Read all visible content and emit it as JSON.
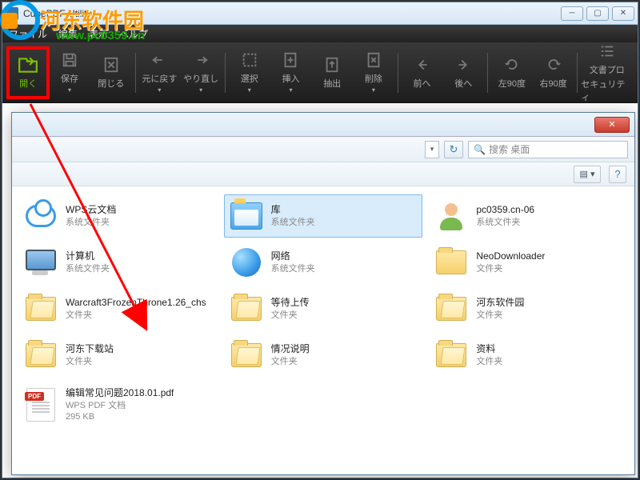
{
  "window": {
    "title": "CubePDF Utility"
  },
  "watermark": {
    "text": "河东软件园",
    "url": "www.pc0359.cn"
  },
  "menu": {
    "file": "ファイル",
    "edit": "編集",
    "view": "表示",
    "help": "ヘルプ"
  },
  "toolbar": {
    "open": "開く",
    "save": "保存",
    "close": "閉じる",
    "undo": "元に戻す",
    "redo": "やり直し",
    "select": "選択",
    "insert": "挿入",
    "extract": "抽出",
    "delete": "削除",
    "prev": "前へ",
    "next": "後へ",
    "rotate_l": "左90度",
    "rotate_r": "右90度",
    "docprops": "文書プロ",
    "security": "セキュリティ"
  },
  "dialog": {
    "search_placeholder": "搜索 桌面",
    "items": [
      {
        "name": "WPS云文档",
        "type": "系统文件夹",
        "icon": "cloud"
      },
      {
        "name": "库",
        "type": "系统文件夹",
        "icon": "lib",
        "selected": true
      },
      {
        "name": "pc0359.cn-06",
        "type": "系统文件夹",
        "icon": "user"
      },
      {
        "name": "计算机",
        "type": "系统文件夹",
        "icon": "computer"
      },
      {
        "name": "网络",
        "type": "系统文件夹",
        "icon": "network"
      },
      {
        "name": "NeoDownloader",
        "type": "文件夹",
        "icon": "folder"
      },
      {
        "name": "Warcraft3FrozenThrone1.26_chs",
        "type": "文件夹",
        "icon": "folder-open"
      },
      {
        "name": "等待上传",
        "type": "文件夹",
        "icon": "folder-open"
      },
      {
        "name": "河东软件园",
        "type": "文件夹",
        "icon": "folder-open"
      },
      {
        "name": "河东下载站",
        "type": "文件夹",
        "icon": "folder-open"
      },
      {
        "name": "情况说明",
        "type": "文件夹",
        "icon": "folder-open"
      },
      {
        "name": "资料",
        "type": "文件夹",
        "icon": "folder-open"
      },
      {
        "name": "编辑常见问题2018.01.pdf",
        "type": "WPS PDF 文档",
        "size": "295 KB",
        "icon": "pdf"
      }
    ]
  }
}
